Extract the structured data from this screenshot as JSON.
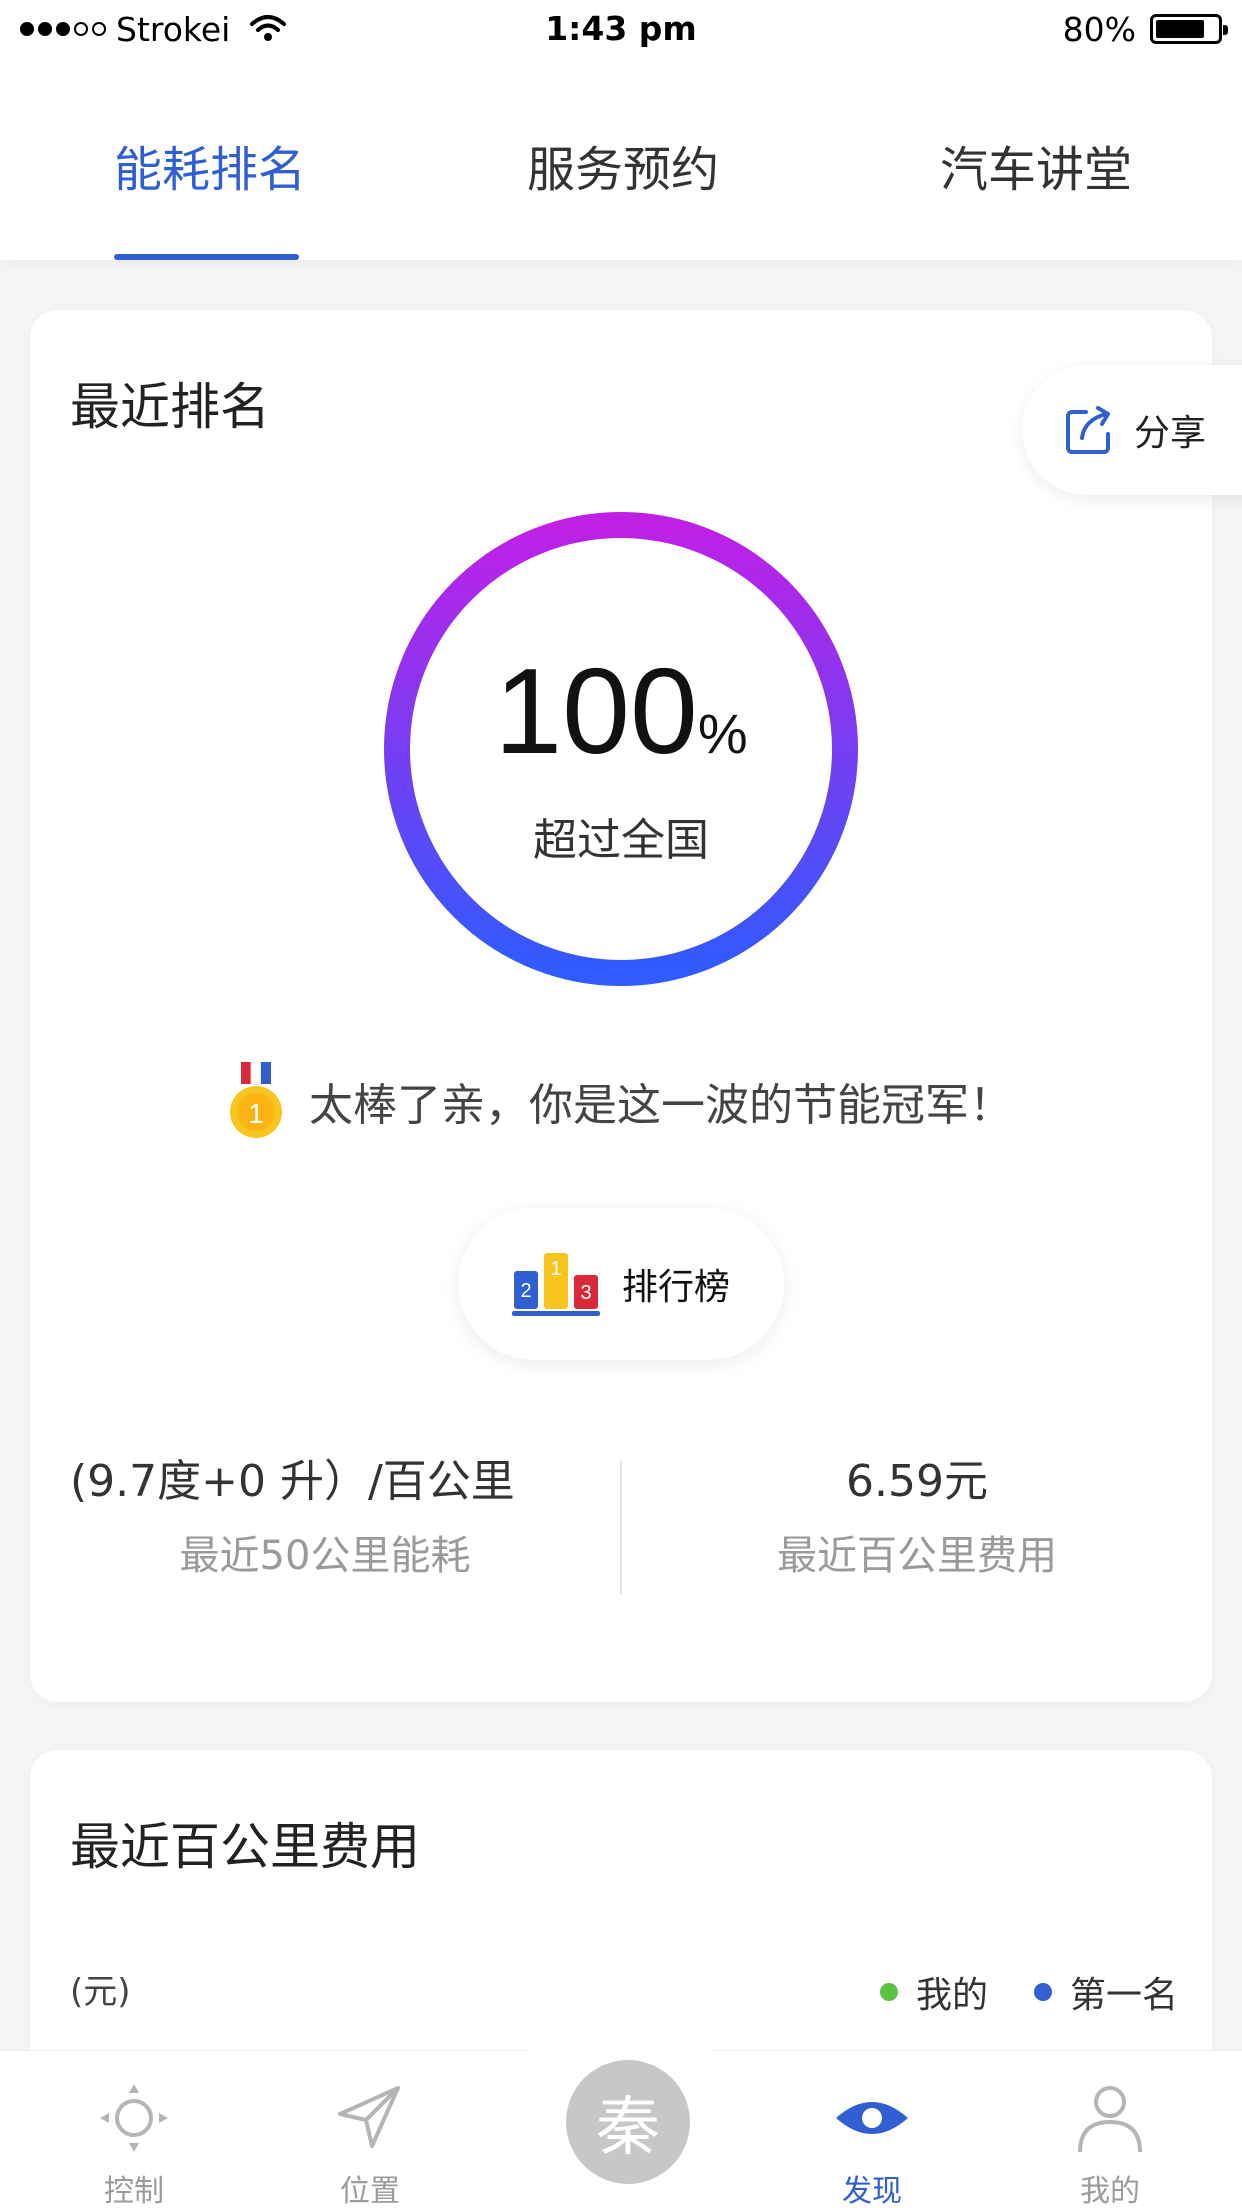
{
  "status_bar": {
    "carrier": "Strokei",
    "time": "1:43 pm",
    "battery": "80%",
    "battery_level": 0.8
  },
  "tabs": [
    {
      "label": "能耗排名",
      "active": true
    },
    {
      "label": "服务预约",
      "active": false
    },
    {
      "label": "汽车讲堂",
      "active": false
    }
  ],
  "ranking": {
    "title": "最近排名",
    "share_label": "分享",
    "percent_value": "100",
    "percent_sign": "%",
    "caption": "超过全国",
    "ring_progress": 1.0,
    "medal_text": "太棒了亲，你是这一波的节能冠军！",
    "leaderboard_label": "排行榜",
    "stats": [
      {
        "value": "(9.7度+0 升）/百公里",
        "label": "最近50公里能耗"
      },
      {
        "value": "6.59元",
        "label": "最近百公里费用"
      }
    ]
  },
  "cost_chart": {
    "title": "最近百公里费用",
    "unit": "(元)",
    "legend": [
      {
        "label": "我的",
        "color": "#5ac33f"
      },
      {
        "label": "第一名",
        "color": "#2f5fd0"
      }
    ]
  },
  "bottom_nav": {
    "items": [
      {
        "label": "控制",
        "icon": "control-icon",
        "active": false
      },
      {
        "label": "位置",
        "icon": "location-arrow-icon",
        "active": false
      },
      {
        "label": "发现",
        "icon": "eye-icon",
        "active": true
      },
      {
        "label": "我的",
        "icon": "profile-icon",
        "active": false
      }
    ],
    "center_glyph": "秦"
  },
  "colors": {
    "accent": "#2f5fd0",
    "ring_start": "#2f5bff",
    "ring_end": "#c020e6"
  }
}
